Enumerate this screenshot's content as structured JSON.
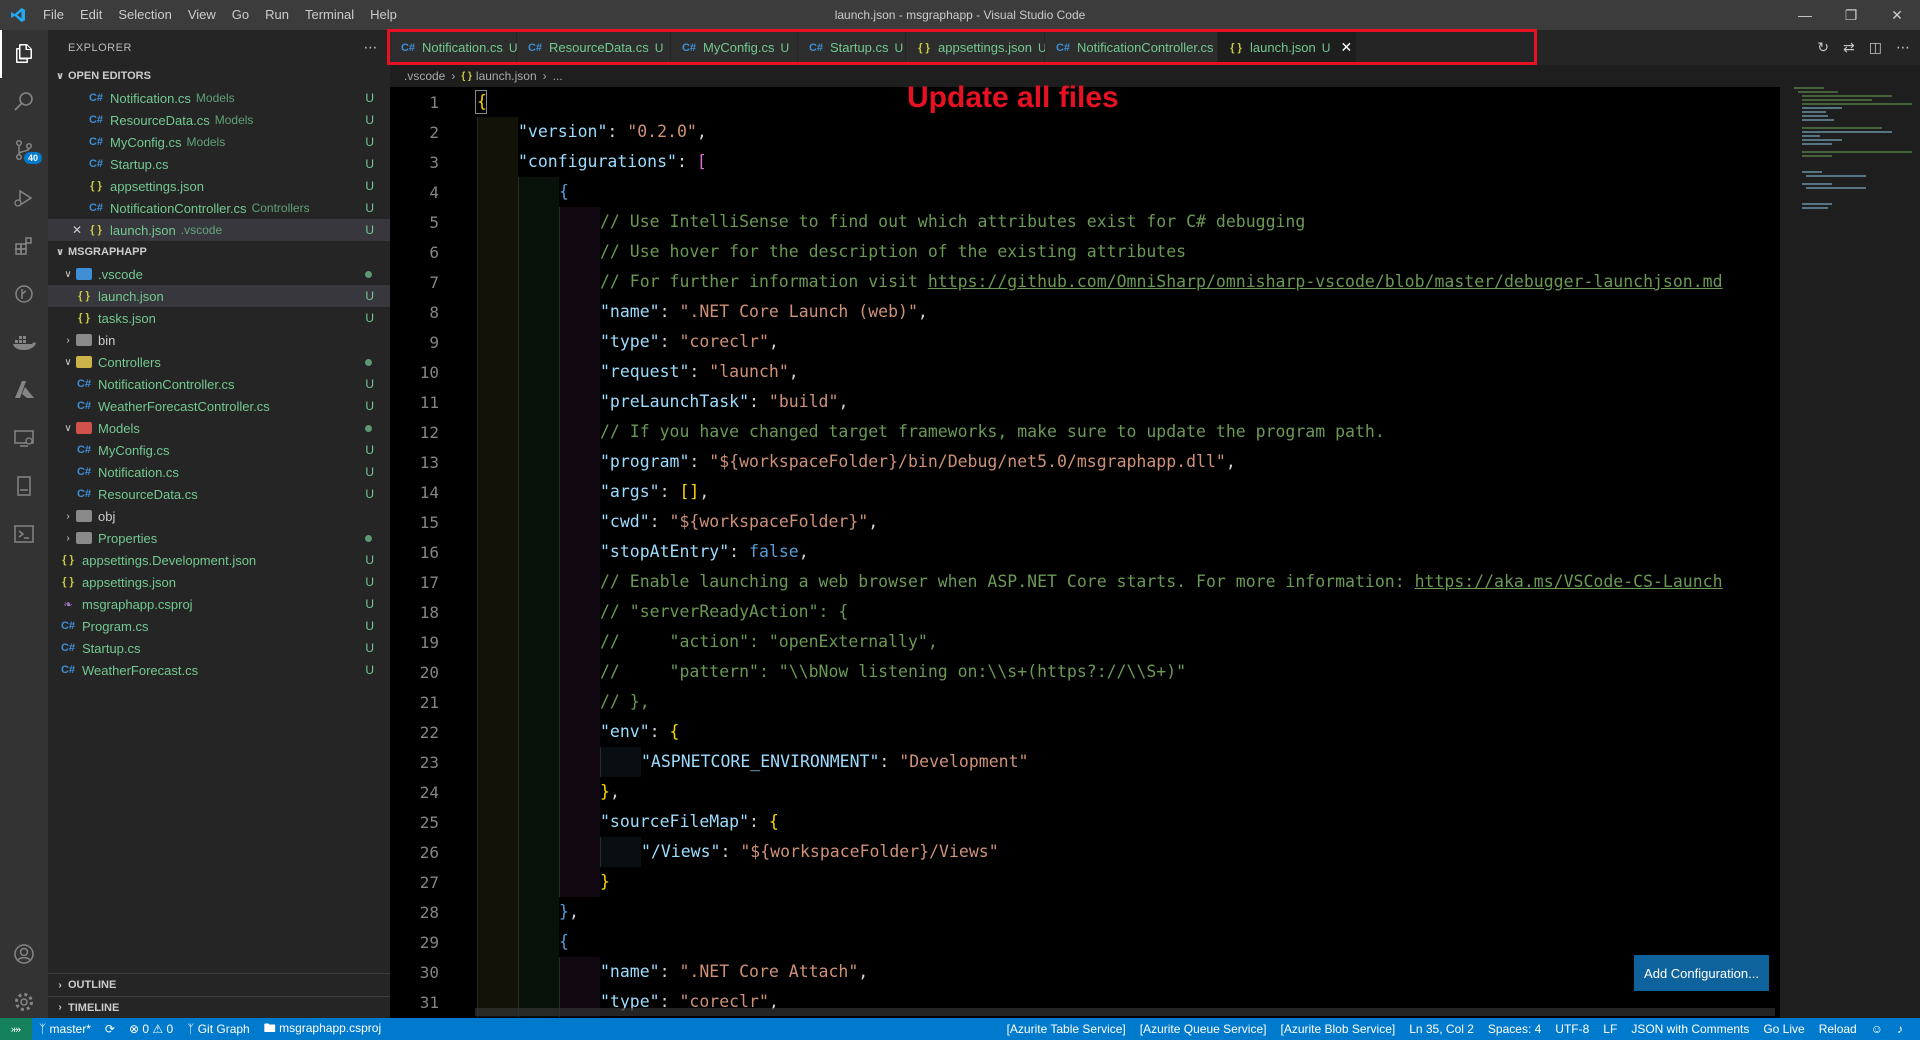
{
  "window": {
    "title": "launch.json - msgraphapp - Visual Studio Code"
  },
  "menu": [
    "File",
    "Edit",
    "Selection",
    "View",
    "Go",
    "Run",
    "Terminal",
    "Help"
  ],
  "activity": {
    "scm_badge": "40"
  },
  "explorer": {
    "title": "EXPLORER",
    "open_editors_title": "OPEN EDITORS",
    "open_editors": [
      {
        "name": "Notification.cs",
        "desc": "Models",
        "status": "U",
        "type": "cs"
      },
      {
        "name": "ResourceData.cs",
        "desc": "Models",
        "status": "U",
        "type": "cs"
      },
      {
        "name": "MyConfig.cs",
        "desc": "Models",
        "status": "U",
        "type": "cs"
      },
      {
        "name": "Startup.cs",
        "desc": "",
        "status": "U",
        "type": "cs"
      },
      {
        "name": "appsettings.json",
        "desc": "",
        "status": "U",
        "type": "json"
      },
      {
        "name": "NotificationController.cs",
        "desc": "Controllers",
        "status": "U",
        "type": "cs"
      },
      {
        "name": "launch.json",
        "desc": ".vscode",
        "status": "U",
        "type": "json"
      }
    ],
    "project_title": "MSGRAPHAPP",
    "tree": [
      {
        "name": ".vscode",
        "kind": "folder-open",
        "depth": 1,
        "dot": true
      },
      {
        "name": "launch.json",
        "kind": "json",
        "depth": 2,
        "status": "U",
        "selected": true
      },
      {
        "name": "tasks.json",
        "kind": "json",
        "depth": 2,
        "status": "U"
      },
      {
        "name": "bin",
        "kind": "folder-closed",
        "depth": 1,
        "plain": true
      },
      {
        "name": "Controllers",
        "kind": "folder-open",
        "depth": 1,
        "dot": true
      },
      {
        "name": "NotificationController.cs",
        "kind": "cs",
        "depth": 2,
        "status": "U"
      },
      {
        "name": "WeatherForecastController.cs",
        "kind": "cs",
        "depth": 2,
        "status": "U"
      },
      {
        "name": "Models",
        "kind": "folder-open",
        "depth": 1,
        "dot": true
      },
      {
        "name": "MyConfig.cs",
        "kind": "cs",
        "depth": 2,
        "status": "U"
      },
      {
        "name": "Notification.cs",
        "kind": "cs",
        "depth": 2,
        "status": "U"
      },
      {
        "name": "ResourceData.cs",
        "kind": "cs",
        "depth": 2,
        "status": "U"
      },
      {
        "name": "obj",
        "kind": "folder-closed",
        "depth": 1,
        "plain": true
      },
      {
        "name": "Properties",
        "kind": "folder-closed",
        "depth": 1,
        "dot": true
      },
      {
        "name": "appsettings.Development.json",
        "kind": "json",
        "depth": 1,
        "status": "U"
      },
      {
        "name": "appsettings.json",
        "kind": "json",
        "depth": 1,
        "status": "U"
      },
      {
        "name": "msgraphapp.csproj",
        "kind": "csproj",
        "depth": 1,
        "status": "U"
      },
      {
        "name": "Program.cs",
        "kind": "cs",
        "depth": 1,
        "status": "U"
      },
      {
        "name": "Startup.cs",
        "kind": "cs",
        "depth": 1,
        "status": "U"
      },
      {
        "name": "WeatherForecast.cs",
        "kind": "cs",
        "depth": 1,
        "status": "U"
      }
    ],
    "outline_title": "OUTLINE",
    "timeline_title": "TIMELINE"
  },
  "tabs": [
    {
      "label": "Notification.cs",
      "status": "U",
      "type": "cs"
    },
    {
      "label": "ResourceData.cs",
      "status": "U",
      "type": "cs"
    },
    {
      "label": "MyConfig.cs",
      "status": "U",
      "type": "cs"
    },
    {
      "label": "Startup.cs",
      "status": "U",
      "type": "cs"
    },
    {
      "label": "appsettings.json",
      "status": "U",
      "type": "json"
    },
    {
      "label": "NotificationController.cs",
      "status": "U",
      "type": "cs"
    },
    {
      "label": "launch.json",
      "status": "U",
      "type": "json",
      "active": true
    }
  ],
  "breadcrumb": [
    ".vscode",
    "launch.json",
    "..."
  ],
  "annotation": "Update all files",
  "code": {
    "line_numbers": [
      1,
      2,
      3,
      4,
      5,
      6,
      7,
      8,
      9,
      10,
      11,
      12,
      13,
      14,
      15,
      16,
      17,
      18,
      19,
      20,
      21,
      22,
      23,
      24,
      25,
      26,
      27,
      28,
      29,
      30,
      31
    ],
    "lines": [
      [
        {
          "t": "{",
          "c": "p1"
        }
      ],
      [
        {
          "t": "\"version\"",
          "c": "k"
        },
        {
          "t": ": "
        },
        {
          "t": "\"0.2.0\"",
          "c": "s"
        },
        {
          "t": ","
        }
      ],
      [
        {
          "t": "\"configurations\"",
          "c": "k"
        },
        {
          "t": ": "
        },
        {
          "t": "[",
          "c": "p2"
        }
      ],
      [
        {
          "t": "{",
          "c": "b"
        }
      ],
      [
        {
          "t": "// Use IntelliSense to find out which attributes exist for C# debugging",
          "c": "c"
        }
      ],
      [
        {
          "t": "// Use hover for the description of the existing attributes",
          "c": "c"
        }
      ],
      [
        {
          "t": "// For further information visit ",
          "c": "c"
        },
        {
          "t": "https://github.com/OmniSharp/omnisharp-vscode/blob/master/debugger-launchjson.md",
          "c": "u"
        }
      ],
      [
        {
          "t": "\"name\"",
          "c": "k"
        },
        {
          "t": ": "
        },
        {
          "t": "\".NET Core Launch (web)\"",
          "c": "s"
        },
        {
          "t": ","
        }
      ],
      [
        {
          "t": "\"type\"",
          "c": "k"
        },
        {
          "t": ": "
        },
        {
          "t": "\"coreclr\"",
          "c": "s"
        },
        {
          "t": ","
        }
      ],
      [
        {
          "t": "\"request\"",
          "c": "k"
        },
        {
          "t": ": "
        },
        {
          "t": "\"launch\"",
          "c": "s"
        },
        {
          "t": ","
        }
      ],
      [
        {
          "t": "\"preLaunchTask\"",
          "c": "k"
        },
        {
          "t": ": "
        },
        {
          "t": "\"build\"",
          "c": "s"
        },
        {
          "t": ","
        }
      ],
      [
        {
          "t": "// If you have changed target frameworks, make sure to update the program path.",
          "c": "c"
        }
      ],
      [
        {
          "t": "\"program\"",
          "c": "k"
        },
        {
          "t": ": "
        },
        {
          "t": "\"${workspaceFolder}/bin/Debug/net5.0/msgraphapp.dll\"",
          "c": "s"
        },
        {
          "t": ","
        }
      ],
      [
        {
          "t": "\"args\"",
          "c": "k"
        },
        {
          "t": ": "
        },
        {
          "t": "[]",
          "c": "p1"
        },
        {
          "t": ","
        }
      ],
      [
        {
          "t": "\"cwd\"",
          "c": "k"
        },
        {
          "t": ": "
        },
        {
          "t": "\"${workspaceFolder}\"",
          "c": "s"
        },
        {
          "t": ","
        }
      ],
      [
        {
          "t": "\"stopAtEntry\"",
          "c": "k"
        },
        {
          "t": ": "
        },
        {
          "t": "false",
          "c": "b"
        },
        {
          "t": ","
        }
      ],
      [
        {
          "t": "// Enable launching a web browser when ASP.NET Core starts. For more information: ",
          "c": "c"
        },
        {
          "t": "https://aka.ms/VSCode-CS-Launch",
          "c": "u"
        }
      ],
      [
        {
          "t": "// \"serverReadyAction\": {",
          "c": "c"
        }
      ],
      [
        {
          "t": "//     \"action\": \"openExternally\",",
          "c": "c"
        }
      ],
      [
        {
          "t": "//     \"pattern\": \"\\\\bNow listening on:\\\\s+(https?://\\\\S+)\"",
          "c": "c"
        }
      ],
      [
        {
          "t": "// },",
          "c": "c"
        }
      ],
      [
        {
          "t": "\"env\"",
          "c": "k"
        },
        {
          "t": ": "
        },
        {
          "t": "{",
          "c": "p1"
        }
      ],
      [
        {
          "t": "\"ASPNETCORE_ENVIRONMENT\"",
          "c": "k"
        },
        {
          "t": ": "
        },
        {
          "t": "\"Development\"",
          "c": "s"
        }
      ],
      [
        {
          "t": "}",
          "c": "p1"
        },
        {
          "t": ","
        }
      ],
      [
        {
          "t": "\"sourceFileMap\"",
          "c": "k"
        },
        {
          "t": ": "
        },
        {
          "t": "{",
          "c": "p1"
        }
      ],
      [
        {
          "t": "\"/Views\"",
          "c": "k"
        },
        {
          "t": ": "
        },
        {
          "t": "\"${workspaceFolder}/Views\"",
          "c": "s"
        }
      ],
      [
        {
          "t": "}",
          "c": "p1"
        }
      ],
      [
        {
          "t": "}",
          "c": "b"
        },
        {
          "t": ","
        }
      ],
      [
        {
          "t": "{",
          "c": "b"
        }
      ],
      [
        {
          "t": "\"name\"",
          "c": "k"
        },
        {
          "t": ": "
        },
        {
          "t": "\".NET Core Attach\"",
          "c": "s"
        },
        {
          "t": ","
        }
      ],
      [
        {
          "t": "\"type\"",
          "c": "k"
        },
        {
          "t": ": "
        },
        {
          "t": "\"coreclr\"",
          "c": "s"
        },
        {
          "t": ","
        }
      ]
    ],
    "indents": [
      0,
      1,
      1,
      2,
      3,
      3,
      3,
      3,
      3,
      3,
      3,
      3,
      3,
      3,
      3,
      3,
      3,
      3,
      3,
      3,
      3,
      3,
      4,
      3,
      3,
      4,
      3,
      2,
      2,
      3,
      3
    ]
  },
  "add_configuration_label": "Add Configuration...",
  "statusbar": {
    "branch": "master*",
    "problems": "0",
    "warnings": "0",
    "git_graph": "Git Graph",
    "project": "msgraphapp.csproj",
    "right_items": [
      "[Azurite Table Service]",
      "[Azurite Queue Service]",
      "[Azurite Blob Service]",
      "Ln 35, Col 2",
      "Spaces: 4",
      "UTF-8",
      "LF",
      "JSON with Comments",
      "Go Live",
      "Reload"
    ]
  },
  "colors": {
    "accent": "#007acc",
    "highlight": "#e81123",
    "untracked": "#73c991"
  }
}
